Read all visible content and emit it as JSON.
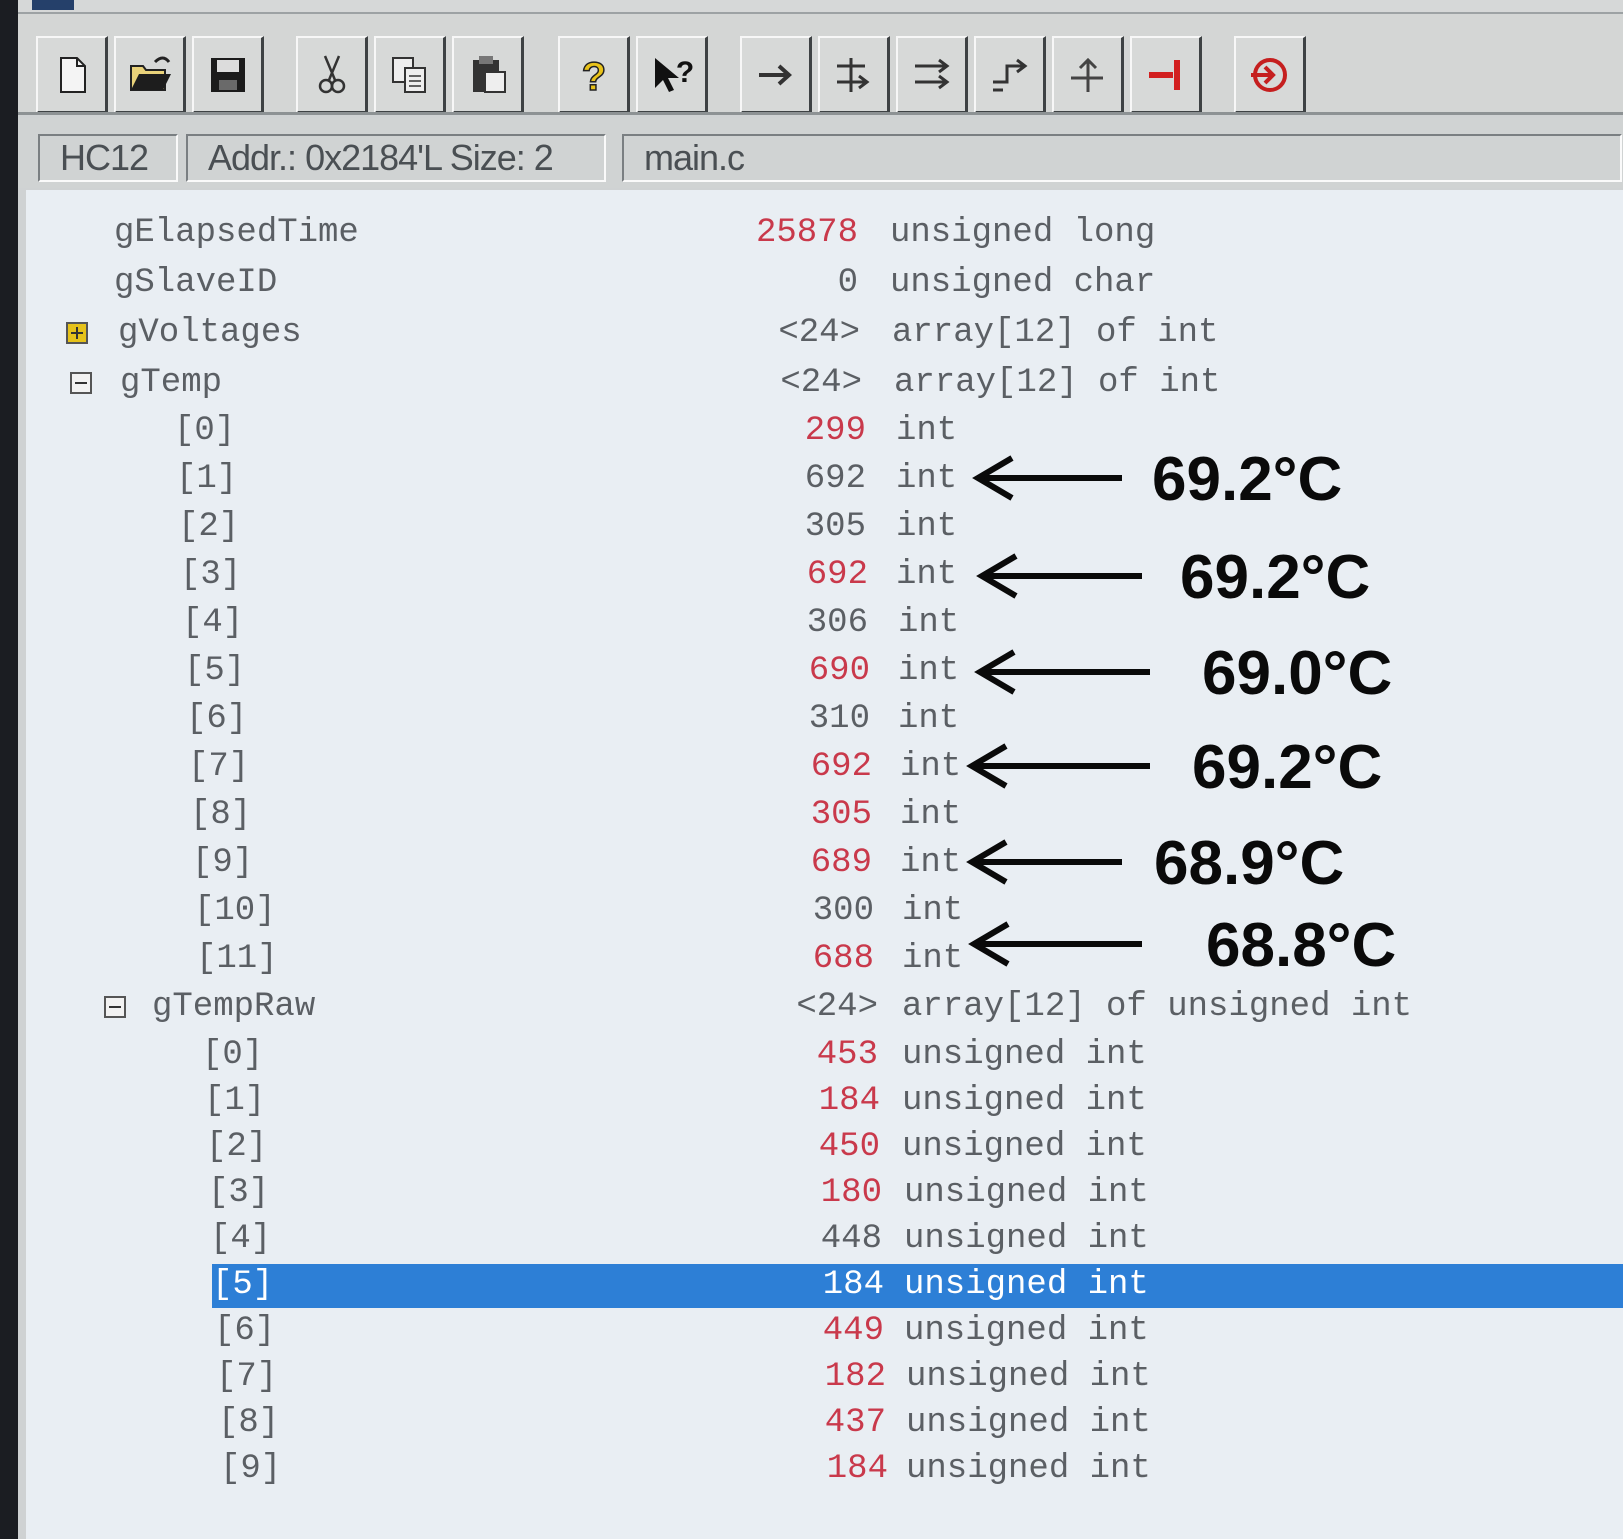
{
  "toolbar": {
    "buttons": [
      {
        "id": "new",
        "icon": "new-file-icon"
      },
      {
        "id": "open",
        "icon": "open-folder-icon"
      },
      {
        "id": "save",
        "icon": "floppy-disk-icon"
      },
      {
        "id": "cut",
        "icon": "scissors-icon"
      },
      {
        "id": "copy",
        "icon": "copy-icon"
      },
      {
        "id": "paste",
        "icon": "clipboard-icon"
      },
      {
        "id": "help",
        "icon": "help-question-icon"
      },
      {
        "id": "context-help",
        "icon": "context-help-icon"
      },
      {
        "id": "start",
        "icon": "run-arrow-icon"
      },
      {
        "id": "single-step",
        "icon": "single-step-icon"
      },
      {
        "id": "step-over",
        "icon": "step-over-icon"
      },
      {
        "id": "step-out",
        "icon": "step-out-icon"
      },
      {
        "id": "assembly-step",
        "icon": "assembly-step-icon"
      },
      {
        "id": "halt",
        "icon": "halt-icon"
      },
      {
        "id": "reset",
        "icon": "reset-icon"
      }
    ]
  },
  "status": {
    "target": "HC12",
    "address": "Addr.: 0x2184'L Size: 2",
    "file": "main.c"
  },
  "colors": {
    "changed_value": "#c9394b",
    "normal_value": "#5b5f64",
    "selection": "#2d7fd6",
    "pane_background": "#e9eef3"
  },
  "variables": {
    "elapsed": {
      "name": "gElapsedTime",
      "value": "25878",
      "type": "unsigned long",
      "changed": true
    },
    "slave": {
      "name": "gSlaveID",
      "value": "0",
      "type": "unsigned char",
      "changed": false
    },
    "voltages": {
      "name": "gVoltages",
      "value": "<24>",
      "type": "array[12] of int",
      "expanded": false,
      "expander_icon": "expand-plus-icon"
    },
    "temp": {
      "name": "gTemp",
      "value": "<24>",
      "type": "array[12] of int",
      "expanded": true,
      "expander_icon": "collapse-minus-icon",
      "items": [
        {
          "index": "[0]",
          "value": "299",
          "type": "int",
          "changed": true
        },
        {
          "index": "[1]",
          "value": "692",
          "type": "int",
          "changed": false
        },
        {
          "index": "[2]",
          "value": "305",
          "type": "int",
          "changed": false
        },
        {
          "index": "[3]",
          "value": "692",
          "type": "int",
          "changed": true
        },
        {
          "index": "[4]",
          "value": "306",
          "type": "int",
          "changed": false
        },
        {
          "index": "[5]",
          "value": "690",
          "type": "int",
          "changed": true
        },
        {
          "index": "[6]",
          "value": "310",
          "type": "int",
          "changed": false
        },
        {
          "index": "[7]",
          "value": "692",
          "type": "int",
          "changed": true
        },
        {
          "index": "[8]",
          "value": "305",
          "type": "int",
          "changed": true
        },
        {
          "index": "[9]",
          "value": "689",
          "type": "int",
          "changed": true
        },
        {
          "index": "[10]",
          "value": "300",
          "type": "int",
          "changed": false
        },
        {
          "index": "[11]",
          "value": "688",
          "type": "int",
          "changed": true
        }
      ]
    },
    "tempraw": {
      "name": "gTempRaw",
      "value": "<24>",
      "type": "array[12] of unsigned int",
      "expanded": true,
      "expander_icon": "collapse-minus-icon",
      "items": [
        {
          "index": "[0]",
          "value": "453",
          "type": "unsigned int",
          "changed": true
        },
        {
          "index": "[1]",
          "value": "184",
          "type": "unsigned int",
          "changed": true
        },
        {
          "index": "[2]",
          "value": "450",
          "type": "unsigned int",
          "changed": true
        },
        {
          "index": "[3]",
          "value": "180",
          "type": "unsigned int",
          "changed": true
        },
        {
          "index": "[4]",
          "value": "448",
          "type": "unsigned int",
          "changed": false
        },
        {
          "index": "[5]",
          "value": "184",
          "type": "unsigned int",
          "changed": false,
          "selected": true
        },
        {
          "index": "[6]",
          "value": "449",
          "type": "unsigned int",
          "changed": true
        },
        {
          "index": "[7]",
          "value": "182",
          "type": "unsigned int",
          "changed": true
        },
        {
          "index": "[8]",
          "value": "437",
          "type": "unsigned int",
          "changed": true
        },
        {
          "index": "[9]",
          "value": "184",
          "type": "unsigned int",
          "changed": true
        }
      ]
    }
  },
  "annotations": [
    {
      "label": "69.2°C",
      "target_index": "[1]"
    },
    {
      "label": "69.2°C",
      "target_index": "[3]"
    },
    {
      "label": "69.0°C",
      "target_index": "[5]"
    },
    {
      "label": "69.2°C",
      "target_index": "[7]"
    },
    {
      "label": "68.9°C",
      "target_index": "[9]"
    },
    {
      "label": "68.8°C",
      "target_index": "[11]"
    }
  ]
}
